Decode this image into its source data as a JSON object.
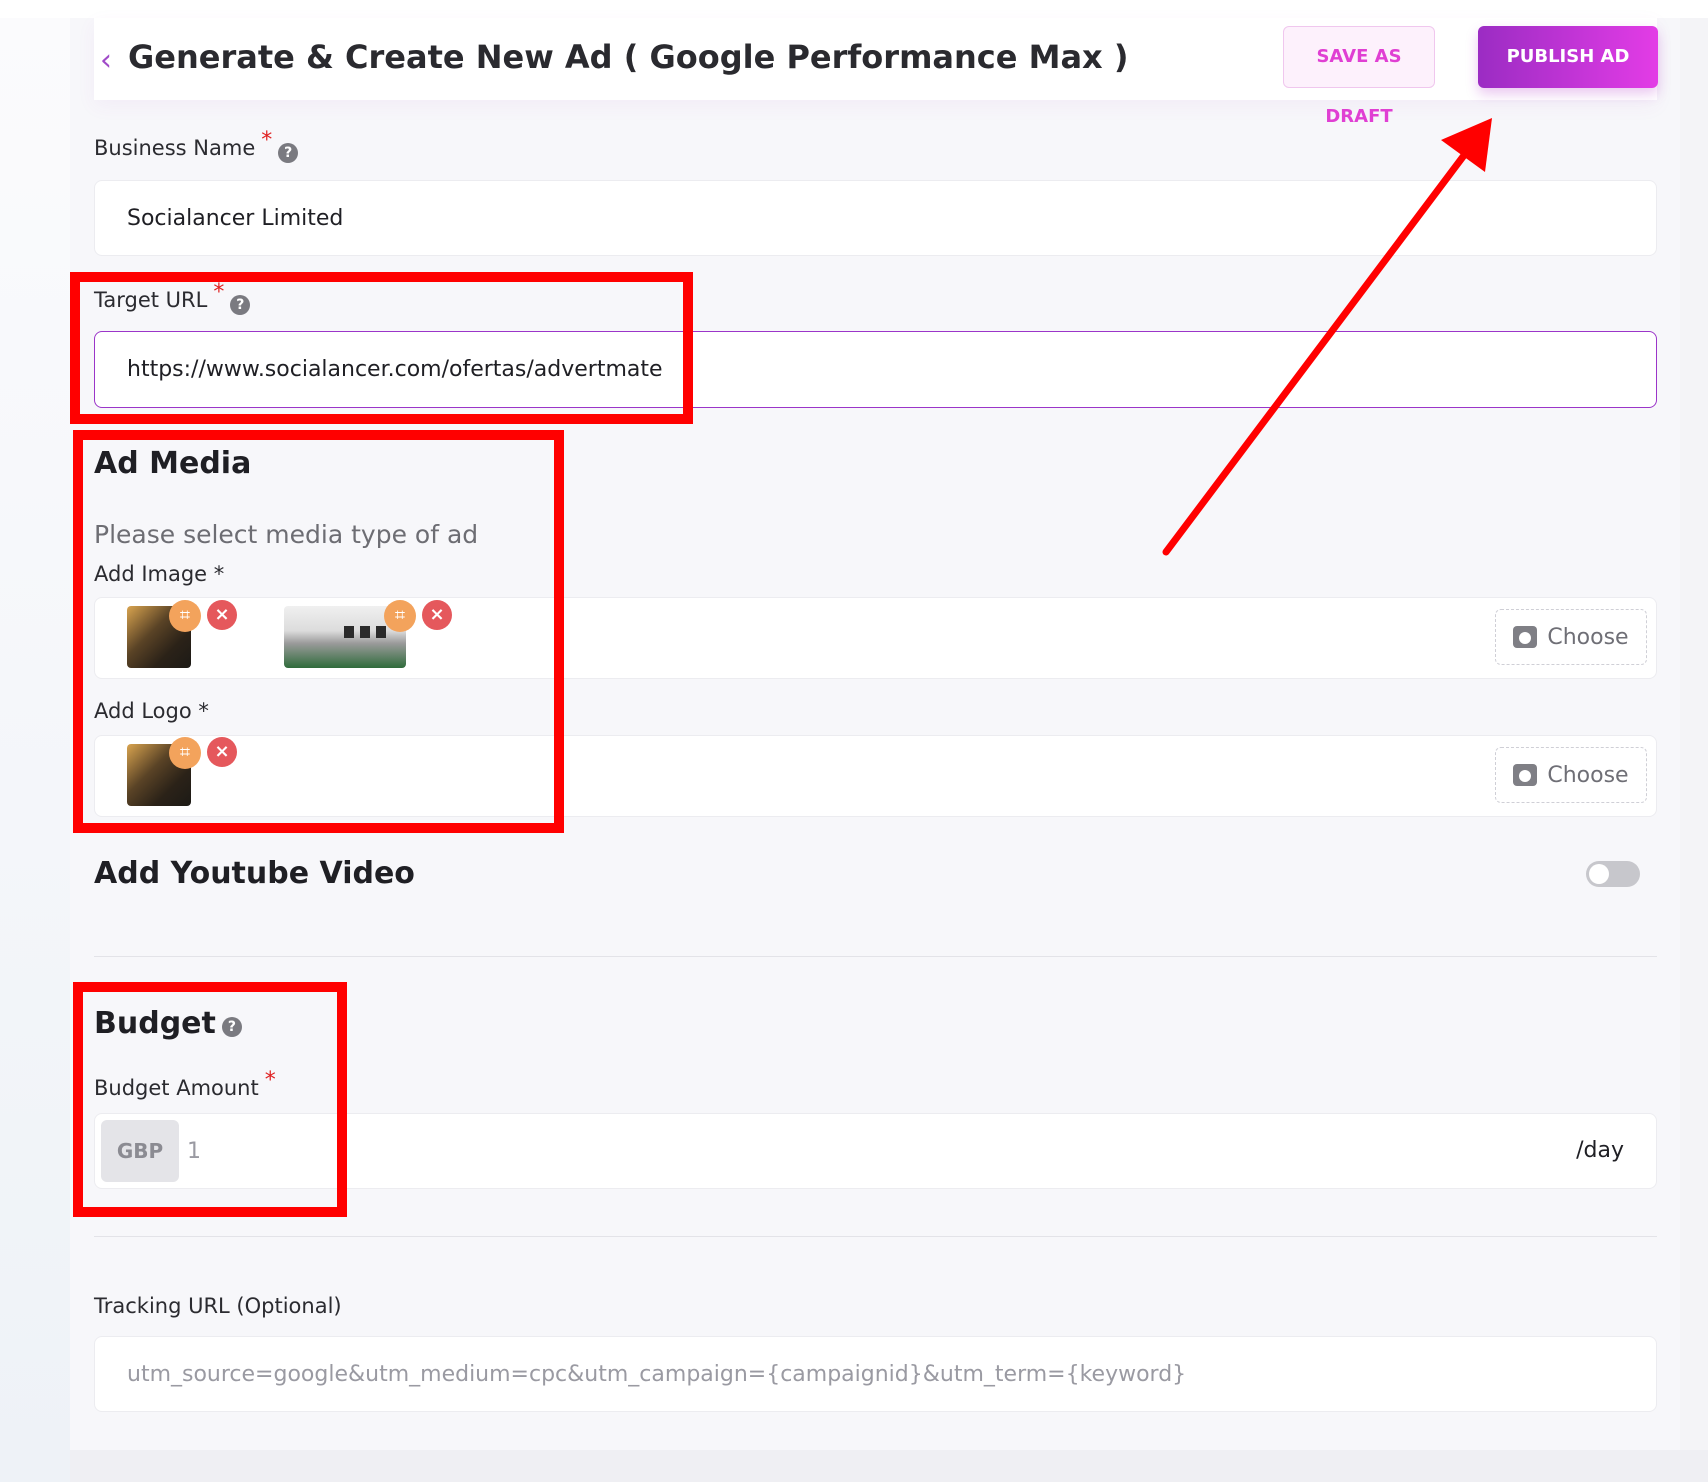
{
  "header": {
    "title": "Generate & Create New Ad ( Google Performance Max )",
    "save_draft_label": "SAVE AS DRAFT",
    "publish_label": "PUBLISH AD"
  },
  "business": {
    "label": "Business Name",
    "required_mark": "*",
    "help_mark": "?",
    "value": "Socialancer Limited"
  },
  "target_url": {
    "label": "Target URL",
    "required_mark": "*",
    "help_mark": "?",
    "value": "https://www.socialancer.com/ofertas/advertmate"
  },
  "ad_media": {
    "title": "Ad Media",
    "subtitle": "Please select media type of ad",
    "add_image_label": "Add Image *",
    "add_logo_label": "Add Logo *",
    "choose_label": "Choose"
  },
  "youtube": {
    "title": "Add Youtube Video",
    "enabled": false
  },
  "budget": {
    "title": "Budget",
    "help_mark": "?",
    "amount_label": "Budget Amount",
    "required_mark": "*",
    "currency": "GBP",
    "placeholder": "1",
    "suffix": "/day"
  },
  "tracking": {
    "label": "Tracking URL (Optional)",
    "placeholder": "utm_source=google&utm_medium=cpc&utm_campaign={campaignid}&utm_term={keyword}"
  },
  "annotation_color": "#ff0000",
  "accent_color": "#9b2cc3"
}
